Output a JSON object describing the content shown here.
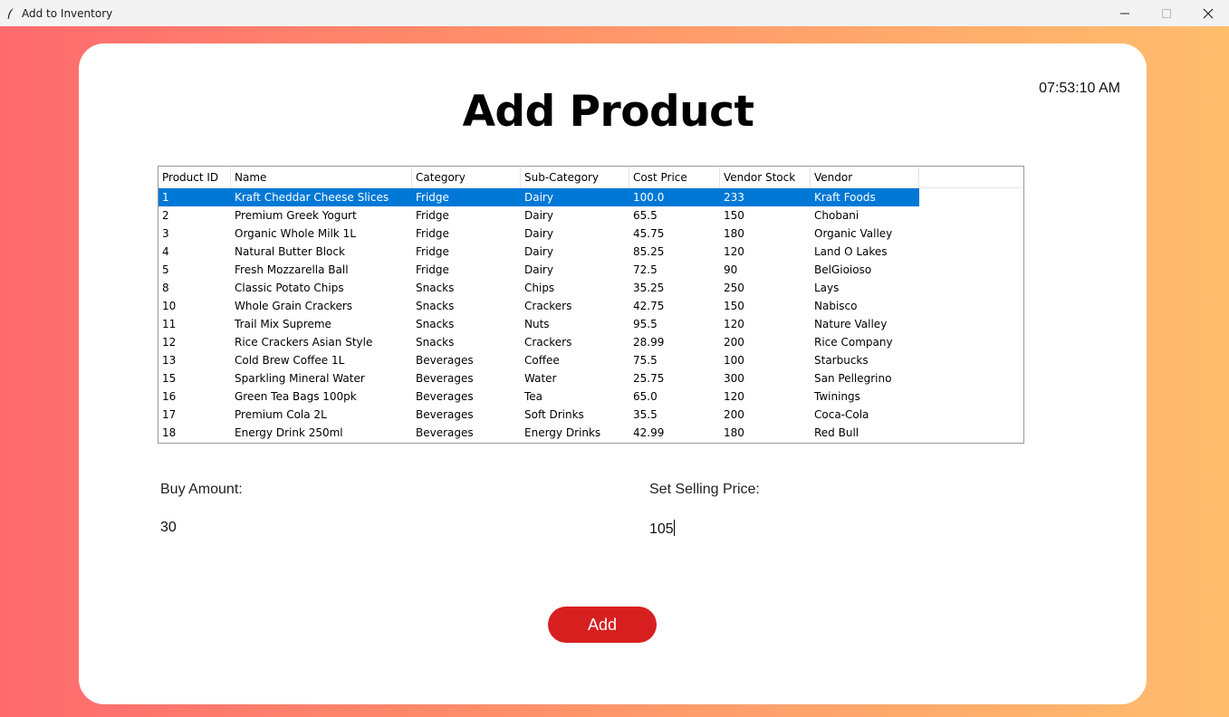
{
  "window": {
    "title": "Add to Inventory",
    "clock": "07:53:10 AM"
  },
  "page": {
    "heading": "Add Product"
  },
  "table": {
    "columns": [
      "Product ID",
      "Name",
      "Category",
      "Sub-Category",
      "Cost Price",
      "Vendor Stock",
      "Vendor"
    ],
    "rows": [
      [
        "1",
        "Kraft Cheddar Cheese Slices",
        "Fridge",
        "Dairy",
        "100.0",
        "233",
        "Kraft Foods"
      ],
      [
        "2",
        "Premium Greek Yogurt",
        "Fridge",
        "Dairy",
        "65.5",
        "150",
        "Chobani"
      ],
      [
        "3",
        "Organic Whole Milk 1L",
        "Fridge",
        "Dairy",
        "45.75",
        "180",
        "Organic Valley"
      ],
      [
        "4",
        "Natural Butter Block",
        "Fridge",
        "Dairy",
        "85.25",
        "120",
        "Land O Lakes"
      ],
      [
        "5",
        "Fresh Mozzarella Ball",
        "Fridge",
        "Dairy",
        "72.5",
        "90",
        "BelGioioso"
      ],
      [
        "8",
        "Classic Potato Chips",
        "Snacks",
        "Chips",
        "35.25",
        "250",
        "Lays"
      ],
      [
        "10",
        "Whole Grain Crackers",
        "Snacks",
        "Crackers",
        "42.75",
        "150",
        "Nabisco"
      ],
      [
        "11",
        "Trail Mix Supreme",
        "Snacks",
        "Nuts",
        "95.5",
        "120",
        "Nature Valley"
      ],
      [
        "12",
        "Rice Crackers Asian Style",
        "Snacks",
        "Crackers",
        "28.99",
        "200",
        "Rice Company"
      ],
      [
        "13",
        "Cold Brew Coffee 1L",
        "Beverages",
        "Coffee",
        "75.5",
        "100",
        "Starbucks"
      ],
      [
        "15",
        "Sparkling Mineral Water",
        "Beverages",
        "Water",
        "25.75",
        "300",
        "San Pellegrino"
      ],
      [
        "16",
        "Green Tea Bags 100pk",
        "Beverages",
        "Tea",
        "65.0",
        "120",
        "Twinings"
      ],
      [
        "17",
        "Premium Cola 2L",
        "Beverages",
        "Soft Drinks",
        "35.5",
        "200",
        "Coca-Cola"
      ],
      [
        "18",
        "Energy Drink 250ml",
        "Beverages",
        "Energy Drinks",
        "42.99",
        "180",
        "Red Bull"
      ]
    ],
    "selected_row": 0
  },
  "form": {
    "buy_amount_label": "Buy Amount:",
    "buy_amount_value": "30",
    "selling_price_label": "Set Selling Price:",
    "selling_price_value": "105",
    "add_label": "Add"
  },
  "colors": {
    "selection": "#0078d7",
    "add_button": "#d81f1f",
    "gradient_left": "#ff6a6f",
    "gradient_right": "#ffbd6d"
  }
}
